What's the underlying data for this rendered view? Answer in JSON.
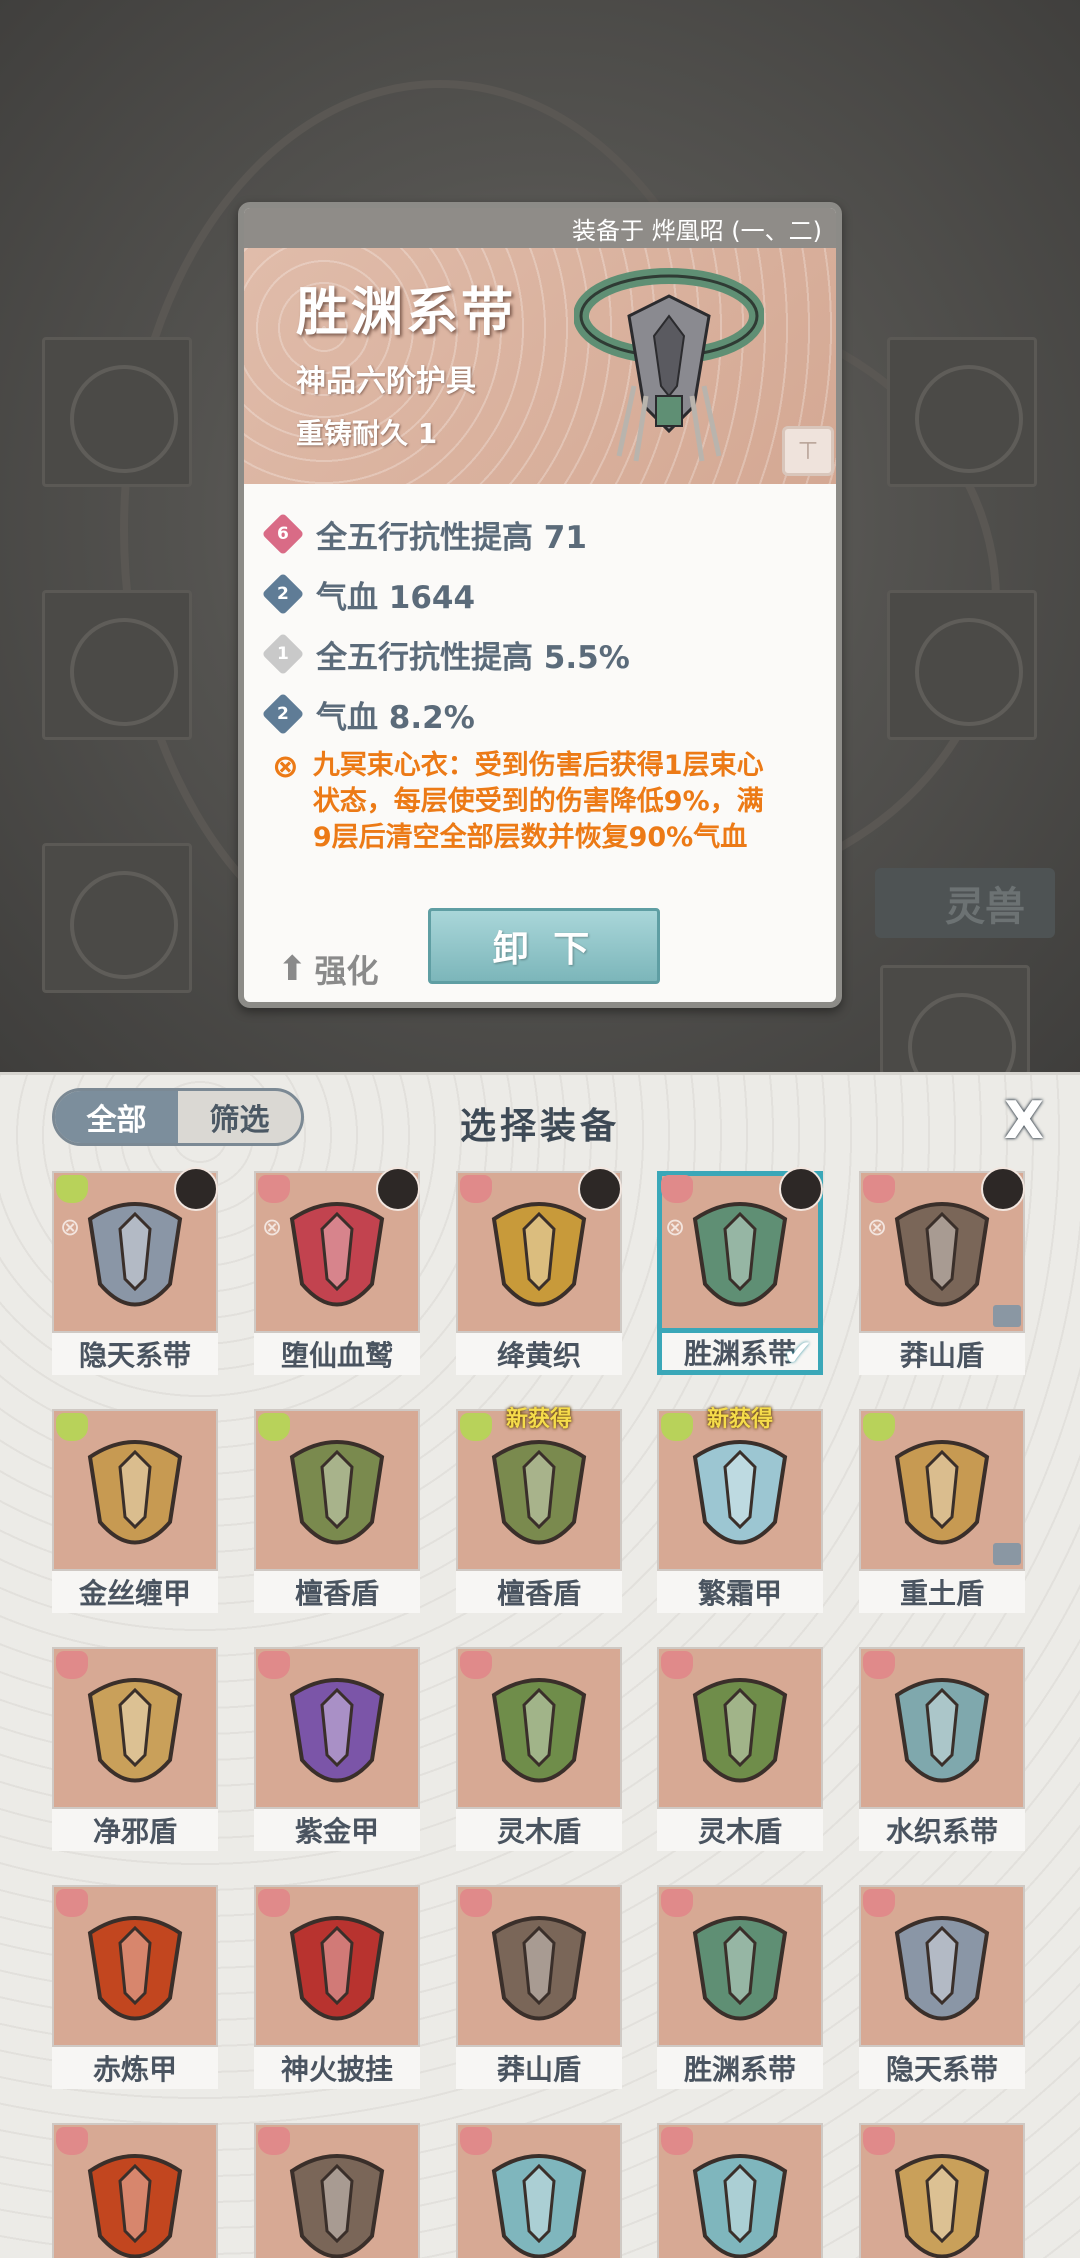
{
  "detail": {
    "equipped_to": "装备于 烨凰昭 (一、二)",
    "name": "胜渊系带",
    "grade": "神品六阶护具",
    "durability": "重铸耐久 1",
    "stats": [
      {
        "badge": "6",
        "color": "pink",
        "text": "全五行抗性提高 71"
      },
      {
        "badge": "2",
        "color": "blue",
        "text": "气血 1644"
      },
      {
        "badge": "1",
        "color": "grey",
        "text": "全五行抗性提高 5.5%"
      },
      {
        "badge": "2",
        "color": "blue",
        "text": "气血 8.2%"
      }
    ],
    "effect_line1": "九冥束心衣：受到伤害后获得1层束心",
    "effect_line2": "状态，每层使受到的伤害降低9%，满",
    "effect_line3": "9层后清空全部层数并恢复90%气血",
    "strengthen_label": "强化",
    "unequip_label": "卸 下"
  },
  "background": {
    "beast_label": "灵兽"
  },
  "panel": {
    "tabs": [
      "全部",
      "筛选"
    ],
    "title": "选择装备",
    "close_label": "X",
    "new_label": "新获得",
    "items": [
      {
        "label": "隐天系带",
        "type": "green",
        "avatar": true,
        "bonded": true,
        "color": "#8a96a6"
      },
      {
        "label": "堕仙血鹫",
        "type": "red",
        "avatar": true,
        "bonded": true,
        "color": "#c2434f"
      },
      {
        "label": "绛黄织",
        "type": "red",
        "avatar": true,
        "bonded": false,
        "color": "#c89a3a"
      },
      {
        "label": "胜渊系带",
        "type": "red",
        "avatar": true,
        "bonded": true,
        "selected": true,
        "color": "#5f8f74"
      },
      {
        "label": "莽山盾",
        "type": "red",
        "avatar": true,
        "bonded": true,
        "lock": true,
        "color": "#7a6658"
      },
      {
        "label": "金丝缠甲",
        "type": "green",
        "color": "#c79a52"
      },
      {
        "label": "檀香盾",
        "type": "green",
        "color": "#7a8a4e"
      },
      {
        "label": "檀香盾",
        "type": "green",
        "new": true,
        "color": "#7a8a4e"
      },
      {
        "label": "繁霜甲",
        "type": "green",
        "new": true,
        "color": "#9cc6d2"
      },
      {
        "label": "重土盾",
        "type": "green",
        "lock": true,
        "color": "#c79a52"
      },
      {
        "label": "净邪盾",
        "type": "red",
        "color": "#c9a05a"
      },
      {
        "label": "紫金甲",
        "type": "red",
        "color": "#7b55a8"
      },
      {
        "label": "灵木盾",
        "type": "red",
        "color": "#6f8d4a"
      },
      {
        "label": "灵木盾",
        "type": "red",
        "color": "#6f8d4a"
      },
      {
        "label": "水织系带",
        "type": "red",
        "color": "#7fa8ad"
      },
      {
        "label": "赤炼甲",
        "type": "red",
        "color": "#c2461f"
      },
      {
        "label": "神火披挂",
        "type": "red",
        "color": "#b8332f"
      },
      {
        "label": "莽山盾",
        "type": "red",
        "color": "#7a6658"
      },
      {
        "label": "胜渊系带",
        "type": "red",
        "color": "#5f8f74"
      },
      {
        "label": "隐天系带",
        "type": "red",
        "color": "#8a96a6"
      },
      {
        "label": "",
        "type": "red",
        "color": "#c2461f"
      },
      {
        "label": "",
        "type": "red",
        "color": "#7a6658"
      },
      {
        "label": "",
        "type": "red",
        "color": "#7fb6bd"
      },
      {
        "label": "",
        "type": "red",
        "color": "#7fb6bd"
      },
      {
        "label": "",
        "type": "red",
        "color": "#c9a05a"
      }
    ]
  }
}
